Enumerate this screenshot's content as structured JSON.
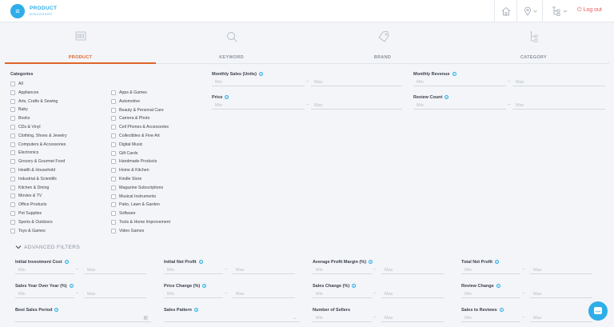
{
  "header": {
    "logo_line1": "PRODUCT",
    "logo_line2": "DISCOVERY",
    "logout": "Log out",
    "icons": [
      "home-icon",
      "location-icon",
      "sitemap-icon"
    ]
  },
  "tabs": [
    {
      "label": "PRODUCT",
      "icon": "barcode-icon",
      "active": true
    },
    {
      "label": "KEYWORD",
      "icon": "search-icon",
      "active": false
    },
    {
      "label": "BRAND",
      "icon": "tag-icon",
      "active": false
    },
    {
      "label": "CATEGORY",
      "icon": "sitemap-icon",
      "active": false
    }
  ],
  "categories": {
    "title": "Categories",
    "col1": [
      "All",
      "Appliances",
      "Arts, Crafts & Sewing",
      "Baby",
      "Books",
      "CDs & Vinyl",
      "Clothing, Shoes & Jewelry",
      "Computers & Accessories",
      "Electronics",
      "Grocery & Gourmet Food",
      "Health & Household",
      "Industrial & Scientific",
      "Kitchen & Dining",
      "Movies & TV",
      "Office Products",
      "Pet Supplies",
      "Sports & Outdoors",
      "Toys & Games"
    ],
    "col2": [
      "Apps & Games",
      "Automotive",
      "Beauty & Personal Care",
      "Camera & Photo",
      "Cell Phones & Accessories",
      "Collectibles & Fine Art",
      "Digital Music",
      "Gift Cards",
      "Handmade Products",
      "Home & Kitchen",
      "Kindle Store",
      "Magazine Subscriptions",
      "Musical Instruments",
      "Patio, Lawn & Garden",
      "Software",
      "Tools & Home Improvement",
      "Video Games"
    ]
  },
  "filters": {
    "monthly_sales": "Monthly Sales (Units)",
    "monthly_revenue": "Monthly Revenue",
    "price": "Price",
    "review_count": "Review Count",
    "min": "Min",
    "max": "Max"
  },
  "advanced": {
    "title": "ADVANCED FILTERS",
    "row1": [
      "Initial Investment Cost",
      "Initial Net Profit",
      "Average Profit Margin (%)",
      "Total Net Profit"
    ],
    "row2": [
      "Sales Year Over Year (%)",
      "Price Change (%)",
      "Sales Change (%)",
      "Review Change"
    ],
    "row3": [
      "Best Sales Period",
      "Sales Pattern",
      "Number of Sellers",
      "Sales to Reviews"
    ]
  }
}
